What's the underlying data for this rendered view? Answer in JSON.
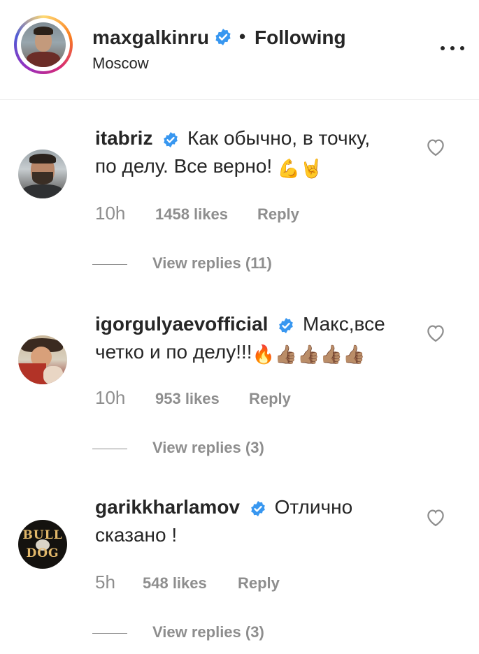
{
  "post_header": {
    "username": "maxgalkinru",
    "separator": "•",
    "follow_state": "Following",
    "location": "Moscow"
  },
  "comments": [
    {
      "username": "itabriz",
      "text": "Как обычно, в точку, по делу. Все верно!",
      "emoji": "💪🤘",
      "time": "10h",
      "likes": "1458 likes",
      "reply_label": "Reply",
      "view_replies": "View replies (11)"
    },
    {
      "username": "igorgulyaevofficial",
      "text": "Макс,все четко и по делу!!!",
      "emoji": "🔥👍🏽👍🏽👍🏽👍🏽",
      "time": "10h",
      "likes": "953 likes",
      "reply_label": "Reply",
      "view_replies": "View replies (3)"
    },
    {
      "username": "garikkharlamov",
      "text": "Отлично сказано !",
      "emoji": "",
      "time": "5h",
      "likes": "548 likes",
      "reply_label": "Reply",
      "view_replies": "View replies (3)"
    }
  ],
  "icons": {
    "verified": "verified-badge-icon",
    "more": "more-options-icon",
    "like": "heart-outline-icon"
  },
  "colors": {
    "text": "#262626",
    "secondary": "#8e8e8e",
    "verified": "#3897f0",
    "divider": "#efefef"
  }
}
